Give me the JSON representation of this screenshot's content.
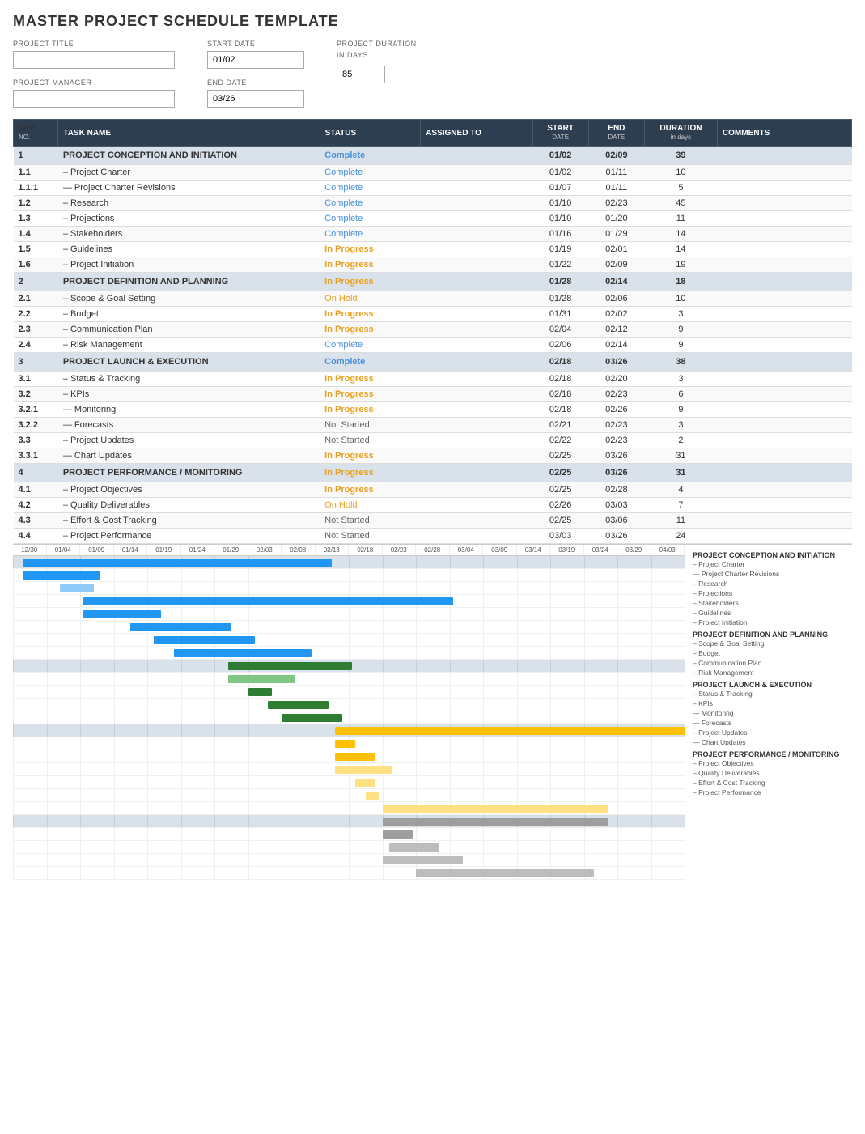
{
  "title": "MASTER PROJECT SCHEDULE TEMPLATE",
  "form": {
    "project_title_label": "PROJECT TITLE",
    "project_title_value": "",
    "project_manager_label": "PROJECT MANAGER",
    "project_manager_value": "",
    "start_date_label": "START DATE",
    "start_date_value": "01/02",
    "end_date_label": "END DATE",
    "end_date_value": "03/26",
    "duration_label": "PROJECT DURATION",
    "duration_sub": "in days",
    "duration_value": "85"
  },
  "table": {
    "headers": [
      {
        "id": "wbs",
        "label": "WBS NO."
      },
      {
        "id": "task",
        "label": "TASK NAME"
      },
      {
        "id": "status",
        "label": "STATUS"
      },
      {
        "id": "assigned",
        "label": "ASSIGNED TO"
      },
      {
        "id": "start",
        "label": "START DATE"
      },
      {
        "id": "end",
        "label": "END DATE"
      },
      {
        "id": "duration",
        "label": "DURATION in days"
      },
      {
        "id": "comments",
        "label": "COMMENTS"
      }
    ],
    "rows": [
      {
        "wbs": "1",
        "task": "PROJECT CONCEPTION AND INITIATION",
        "status": "Complete",
        "assigned": "",
        "start": "01/02",
        "end": "02/09",
        "duration": "39",
        "comments": "",
        "section": true
      },
      {
        "wbs": "1.1",
        "task": "– Project Charter",
        "status": "Complete",
        "assigned": "",
        "start": "01/02",
        "end": "01/11",
        "duration": "10",
        "comments": "",
        "section": false
      },
      {
        "wbs": "1.1.1",
        "task": "— Project Charter Revisions",
        "status": "Complete",
        "assigned": "",
        "start": "01/07",
        "end": "01/11",
        "duration": "5",
        "comments": "",
        "section": false
      },
      {
        "wbs": "1.2",
        "task": "– Research",
        "status": "Complete",
        "assigned": "",
        "start": "01/10",
        "end": "02/23",
        "duration": "45",
        "comments": "",
        "section": false
      },
      {
        "wbs": "1.3",
        "task": "– Projections",
        "status": "Complete",
        "assigned": "",
        "start": "01/10",
        "end": "01/20",
        "duration": "11",
        "comments": "",
        "section": false
      },
      {
        "wbs": "1.4",
        "task": "– Stakeholders",
        "status": "Complete",
        "assigned": "",
        "start": "01/16",
        "end": "01/29",
        "duration": "14",
        "comments": "",
        "section": false
      },
      {
        "wbs": "1.5",
        "task": "– Guidelines",
        "status": "In Progress",
        "assigned": "",
        "start": "01/19",
        "end": "02/01",
        "duration": "14",
        "comments": "",
        "section": false
      },
      {
        "wbs": "1.6",
        "task": "– Project Initiation",
        "status": "In Progress",
        "assigned": "",
        "start": "01/22",
        "end": "02/09",
        "duration": "19",
        "comments": "",
        "section": false
      },
      {
        "wbs": "2",
        "task": "PROJECT DEFINITION AND PLANNING",
        "status": "In Progress",
        "assigned": "",
        "start": "01/28",
        "end": "02/14",
        "duration": "18",
        "comments": "",
        "section": true
      },
      {
        "wbs": "2.1",
        "task": "– Scope & Goal Setting",
        "status": "On Hold",
        "assigned": "",
        "start": "01/28",
        "end": "02/06",
        "duration": "10",
        "comments": "",
        "section": false
      },
      {
        "wbs": "2.2",
        "task": "– Budget",
        "status": "In Progress",
        "assigned": "",
        "start": "01/31",
        "end": "02/02",
        "duration": "3",
        "comments": "",
        "section": false
      },
      {
        "wbs": "2.3",
        "task": "– Communication Plan",
        "status": "In Progress",
        "assigned": "",
        "start": "02/04",
        "end": "02/12",
        "duration": "9",
        "comments": "",
        "section": false
      },
      {
        "wbs": "2.4",
        "task": "– Risk Management",
        "status": "Complete",
        "assigned": "",
        "start": "02/06",
        "end": "02/14",
        "duration": "9",
        "comments": "",
        "section": false
      },
      {
        "wbs": "3",
        "task": "PROJECT LAUNCH & EXECUTION",
        "status": "Complete",
        "assigned": "",
        "start": "02/18",
        "end": "03/26",
        "duration": "38",
        "comments": "",
        "section": true
      },
      {
        "wbs": "3.1",
        "task": "– Status & Tracking",
        "status": "In Progress",
        "assigned": "",
        "start": "02/18",
        "end": "02/20",
        "duration": "3",
        "comments": "",
        "section": false
      },
      {
        "wbs": "3.2",
        "task": "– KPIs",
        "status": "In Progress",
        "assigned": "",
        "start": "02/18",
        "end": "02/23",
        "duration": "6",
        "comments": "",
        "section": false
      },
      {
        "wbs": "3.2.1",
        "task": "— Monitoring",
        "status": "In Progress",
        "assigned": "",
        "start": "02/18",
        "end": "02/26",
        "duration": "9",
        "comments": "",
        "section": false
      },
      {
        "wbs": "3.2.2",
        "task": "— Forecasts",
        "status": "Not Started",
        "assigned": "",
        "start": "02/21",
        "end": "02/23",
        "duration": "3",
        "comments": "",
        "section": false
      },
      {
        "wbs": "3.3",
        "task": "– Project Updates",
        "status": "Not Started",
        "assigned": "",
        "start": "02/22",
        "end": "02/23",
        "duration": "2",
        "comments": "",
        "section": false
      },
      {
        "wbs": "3.3.1",
        "task": "— Chart Updates",
        "status": "In Progress",
        "assigned": "",
        "start": "02/25",
        "end": "03/26",
        "duration": "31",
        "comments": "",
        "section": false
      },
      {
        "wbs": "4",
        "task": "PROJECT PERFORMANCE / MONITORING",
        "status": "In Progress",
        "assigned": "",
        "start": "02/25",
        "end": "03/26",
        "duration": "31",
        "comments": "",
        "section": true
      },
      {
        "wbs": "4.1",
        "task": "– Project Objectives",
        "status": "In Progress",
        "assigned": "",
        "start": "02/25",
        "end": "02/28",
        "duration": "4",
        "comments": "",
        "section": false
      },
      {
        "wbs": "4.2",
        "task": "– Quality Deliverables",
        "status": "On Hold",
        "assigned": "",
        "start": "02/26",
        "end": "03/03",
        "duration": "7",
        "comments": "",
        "section": false
      },
      {
        "wbs": "4.3",
        "task": "– Effort & Cost Tracking",
        "status": "Not Started",
        "assigned": "",
        "start": "02/25",
        "end": "03/06",
        "duration": "11",
        "comments": "",
        "section": false
      },
      {
        "wbs": "4.4",
        "task": "– Project Performance",
        "status": "Not Started",
        "assigned": "",
        "start": "03/03",
        "end": "03/26",
        "duration": "24",
        "comments": "",
        "section": false
      }
    ]
  },
  "gantt": {
    "date_labels": [
      "12/30",
      "01/04",
      "01/09",
      "01/14",
      "01/19",
      "01/24",
      "01/29",
      "02/03",
      "02/08",
      "02/13",
      "02/18",
      "02/23",
      "02/28",
      "03/04",
      "03/09",
      "03/14",
      "03/19",
      "03/24",
      "03/29",
      "04/03"
    ],
    "legend": [
      {
        "type": "section",
        "label": "PROJECT CONCEPTION AND INITIATION"
      },
      {
        "type": "item",
        "label": "– Project Charter"
      },
      {
        "type": "item",
        "label": "— Project Charter Revisions"
      },
      {
        "type": "item",
        "label": "– Research"
      },
      {
        "type": "item",
        "label": "– Projections"
      },
      {
        "type": "item",
        "label": "– Stakeholders"
      },
      {
        "type": "item",
        "label": "– Guidelines"
      },
      {
        "type": "item",
        "label": "– Project Initiation"
      },
      {
        "type": "section",
        "label": "PROJECT DEFINITION AND PLANNING"
      },
      {
        "type": "item",
        "label": "– Scope & Goal Setting"
      },
      {
        "type": "item",
        "label": "– Budget"
      },
      {
        "type": "item",
        "label": "– Communication Plan"
      },
      {
        "type": "item",
        "label": "– Risk Management"
      },
      {
        "type": "section",
        "label": "PROJECT LAUNCH & EXECUTION"
      },
      {
        "type": "item",
        "label": "– Status & Tracking"
      },
      {
        "type": "item",
        "label": "– KPIs"
      },
      {
        "type": "item",
        "label": "— Monitoring"
      },
      {
        "type": "item",
        "label": "— Forecasts"
      },
      {
        "type": "item",
        "label": "– Project Updates"
      },
      {
        "type": "item",
        "label": "— Chart Updates"
      },
      {
        "type": "section",
        "label": "PROJECT PERFORMANCE / MONITORING"
      },
      {
        "type": "item",
        "label": "– Project Objectives"
      },
      {
        "type": "item",
        "label": "– Quality Deliverables"
      },
      {
        "type": "item",
        "label": "– Effort & Cost Tracking"
      },
      {
        "type": "item",
        "label": "– Project Performance"
      }
    ]
  }
}
